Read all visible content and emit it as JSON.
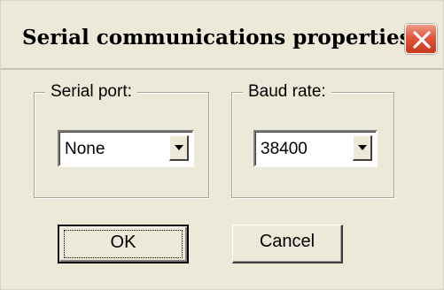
{
  "dialog": {
    "title": "Serial communications properties",
    "close_icon": "close-icon"
  },
  "serial_port": {
    "group_label": "Serial port:",
    "selected_value": "None",
    "arrow_icon": "dropdown-arrow-icon"
  },
  "baud_rate": {
    "group_label": "Baud rate:",
    "selected_value": "38400",
    "arrow_icon": "dropdown-arrow-icon"
  },
  "buttons": {
    "ok_label": "OK",
    "cancel_label": "Cancel"
  },
  "colors": {
    "dialog_face": "#ece9d8",
    "close_button": "#e0573c"
  }
}
